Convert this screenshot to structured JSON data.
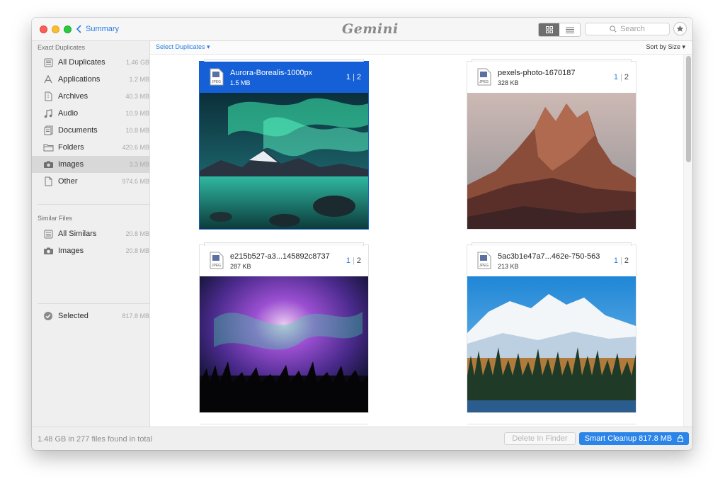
{
  "app": {
    "logo_text": "Gemini",
    "back_label": "Summary",
    "search_placeholder": "Search"
  },
  "sidebar": {
    "exact_title": "Exact Duplicates",
    "exact_items": [
      {
        "label": "All Duplicates",
        "size": "1.46 GB",
        "icon": "all-duplicates-icon"
      },
      {
        "label": "Applications",
        "size": "1.2 MB",
        "icon": "applications-icon"
      },
      {
        "label": "Archives",
        "size": "40.3 MB",
        "icon": "archive-icon"
      },
      {
        "label": "Audio",
        "size": "10.9 MB",
        "icon": "music-note-icon"
      },
      {
        "label": "Documents",
        "size": "10.8 MB",
        "icon": "documents-icon"
      },
      {
        "label": "Folders",
        "size": "420.6 MB",
        "icon": "folder-icon"
      },
      {
        "label": "Images",
        "size": "3.3 MB",
        "icon": "camera-icon",
        "selected": true
      },
      {
        "label": "Other",
        "size": "974.6 MB",
        "icon": "file-icon"
      }
    ],
    "similar_title": "Similar Files",
    "similar_items": [
      {
        "label": "All Similars",
        "size": "20.8 MB",
        "icon": "all-similars-icon"
      },
      {
        "label": "Images",
        "size": "20.8 MB",
        "icon": "camera-icon"
      }
    ],
    "selected_item": {
      "label": "Selected",
      "size": "817.8 MB",
      "icon": "check-circle-icon"
    }
  },
  "toolbar": {
    "select_duplicates": "Select Duplicates ▾",
    "sort_by": "Sort by Size ▾"
  },
  "cards": [
    {
      "name": "Aurora-Borealis-1000px",
      "size": "1.5 MB",
      "count_a": "1",
      "count_b": "2",
      "type": "JPEG",
      "selected": true
    },
    {
      "name": "pexels-photo-1670187",
      "size": "328 KB",
      "count_a": "1",
      "count_b": "2",
      "type": "JPEG",
      "selected": false
    },
    {
      "name": "e215b527-a3...145892c8737",
      "size": "287 KB",
      "count_a": "1",
      "count_b": "2",
      "type": "JPEG",
      "selected": false
    },
    {
      "name": "5ac3b1e47a7...462e-750-563",
      "size": "213 KB",
      "count_a": "1",
      "count_b": "2",
      "type": "JPEG",
      "selected": false
    }
  ],
  "footer": {
    "summary": "1.48 GB in 277 files found in total",
    "delete_label": "Delete In Finder",
    "smart_label": "Smart Cleanup 817.8 MB"
  },
  "colors": {
    "accent": "#2b84e8",
    "selection": "#1560d6"
  }
}
